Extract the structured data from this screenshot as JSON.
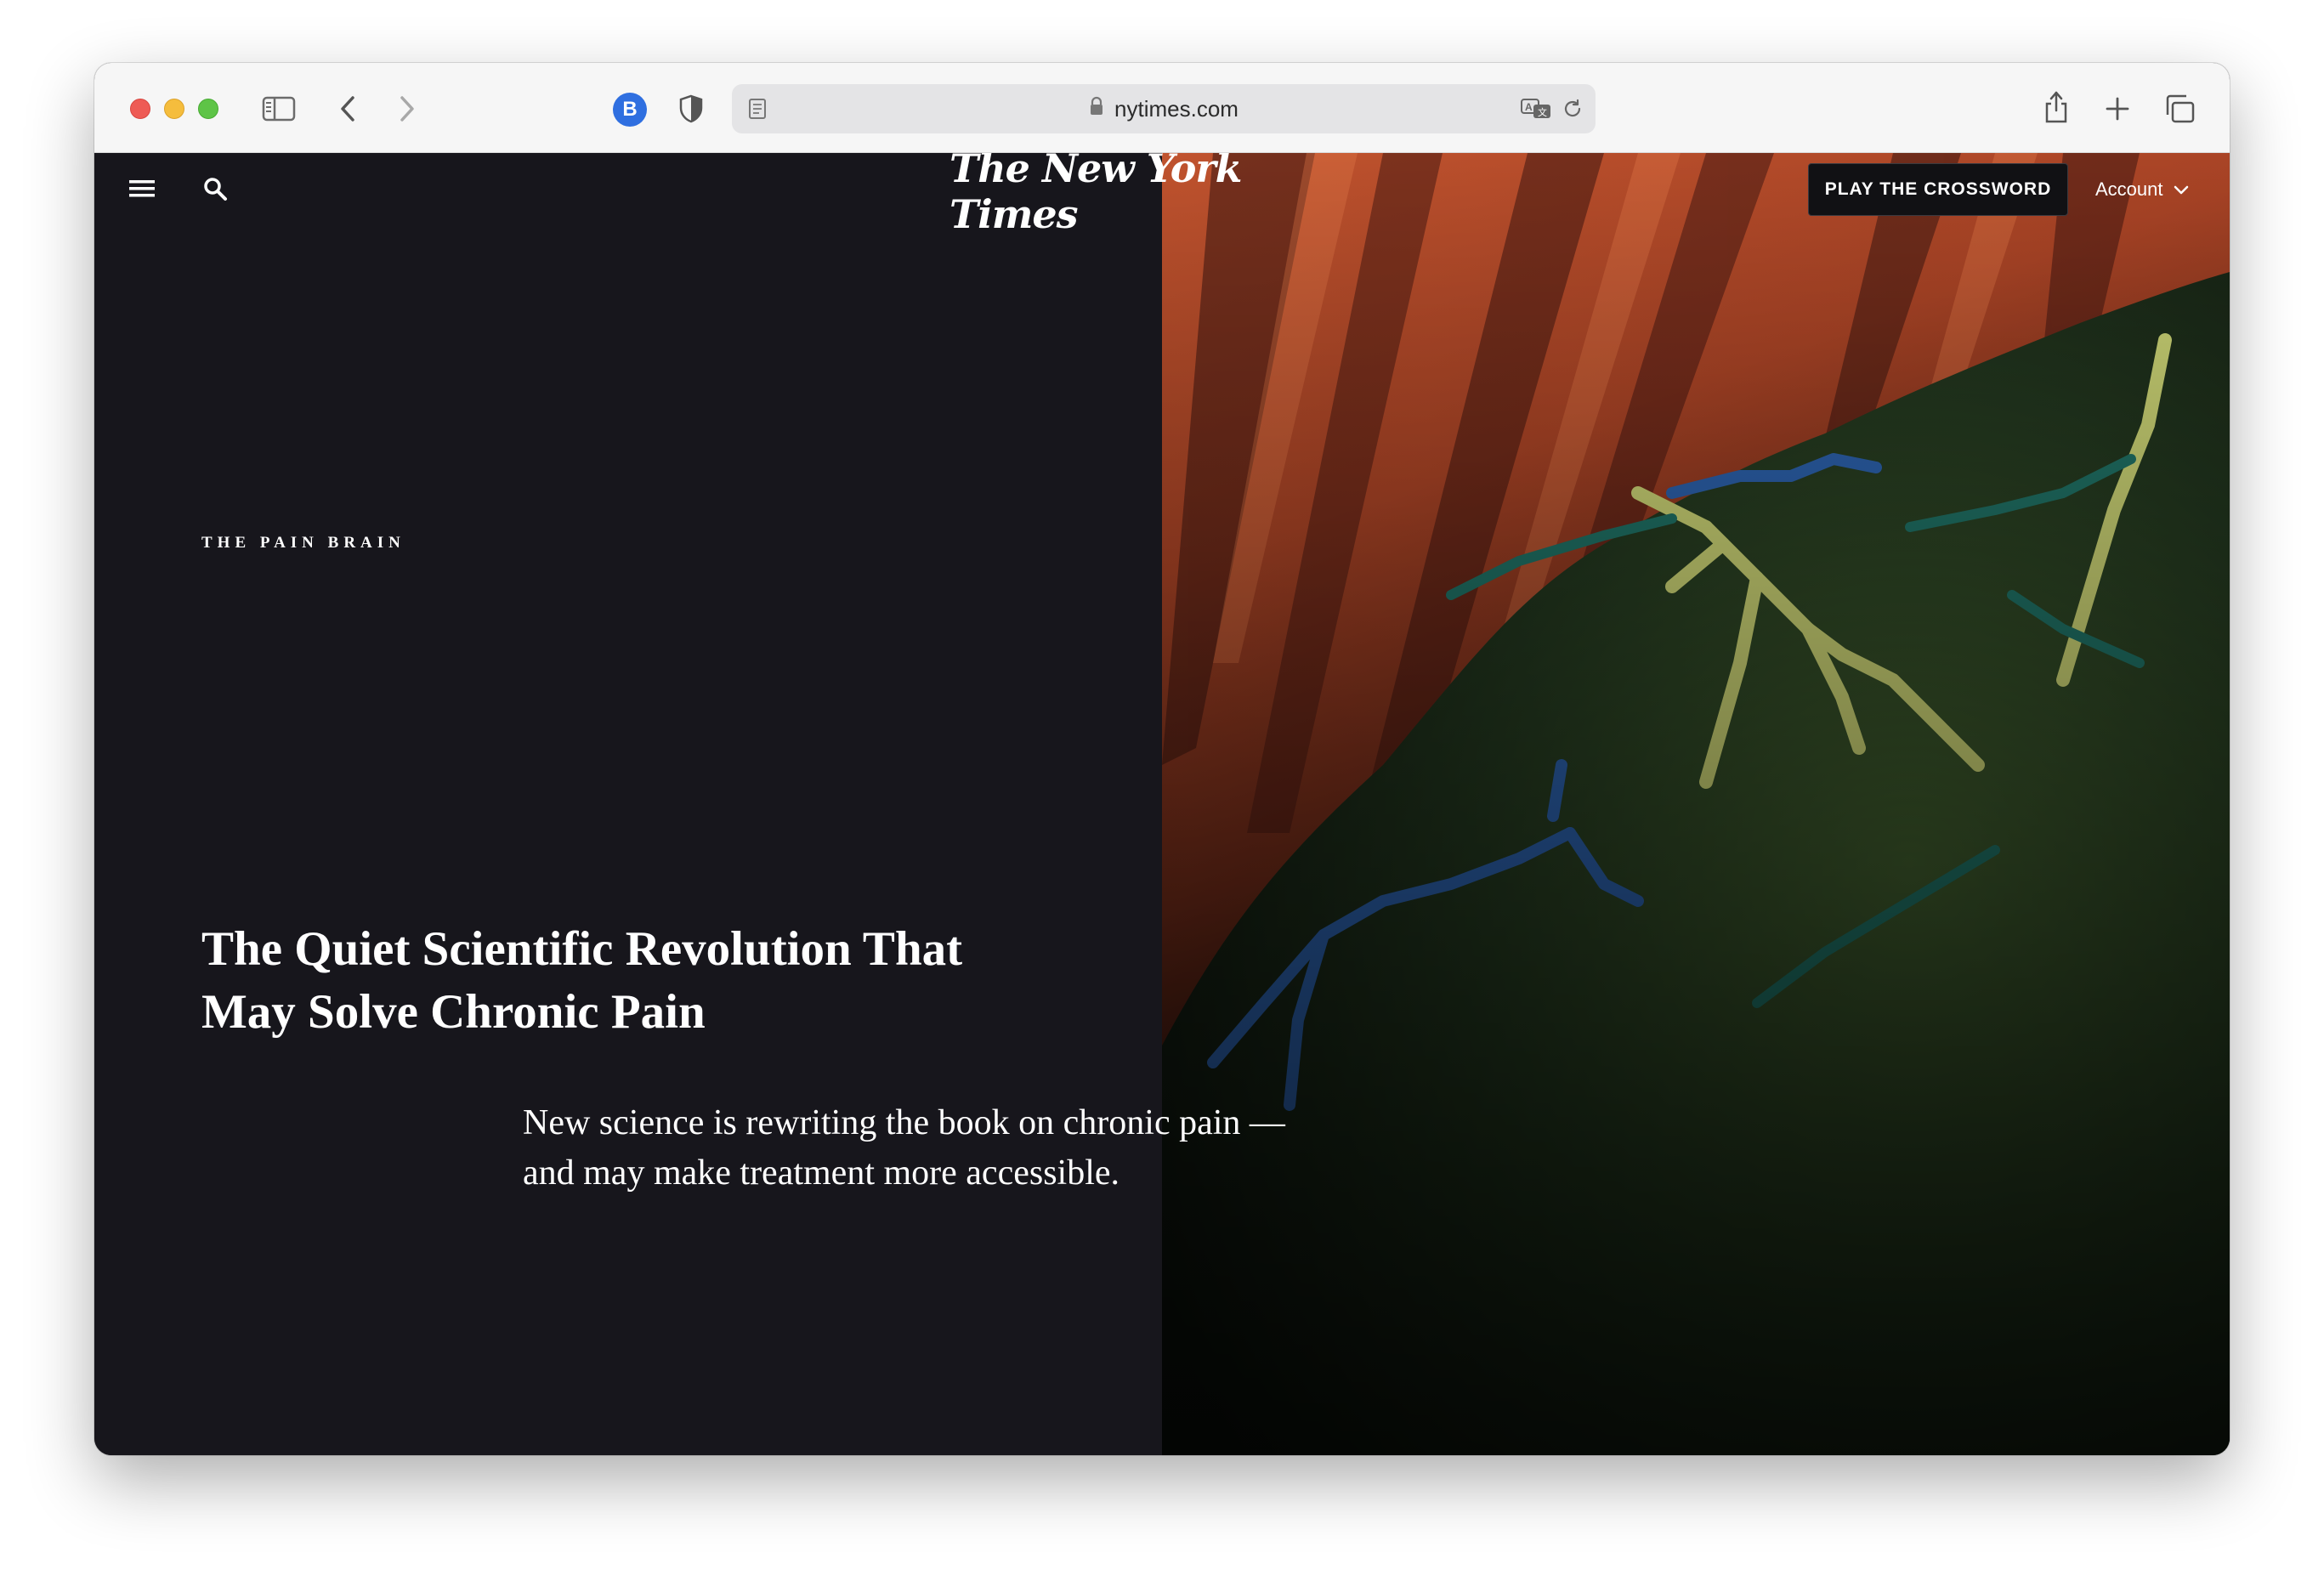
{
  "browser": {
    "url": "nytimes.com",
    "extension_badge": "B"
  },
  "nav": {
    "masthead": "The New York Times",
    "crossword_button": "PLAY THE CROSSWORD",
    "account_label": "Account"
  },
  "article": {
    "kicker": "THE PAIN BRAIN",
    "headline_line1": "The Quiet Scientific Revolution That",
    "headline_line2": "May Solve Chronic Pain",
    "summary_line1": "New science is rewriting the book on chronic pain —",
    "summary_line2": "and may make treatment more accessible."
  },
  "colors": {
    "page_background": "#17161c",
    "toolbar_background": "#f6f6f6",
    "hero_orange": "#c0532e",
    "text": "#ffffff"
  },
  "icons": {
    "toolbar": [
      "sidebar-icon",
      "back-chevron-icon",
      "forward-chevron-icon",
      "bitwarden-icon",
      "shield-icon",
      "reader-icon",
      "lock-icon",
      "translate-icon",
      "reload-icon",
      "share-icon",
      "plus-icon",
      "tabs-icon"
    ],
    "page": [
      "hamburger-menu-icon",
      "search-icon",
      "chevron-down-icon"
    ]
  }
}
